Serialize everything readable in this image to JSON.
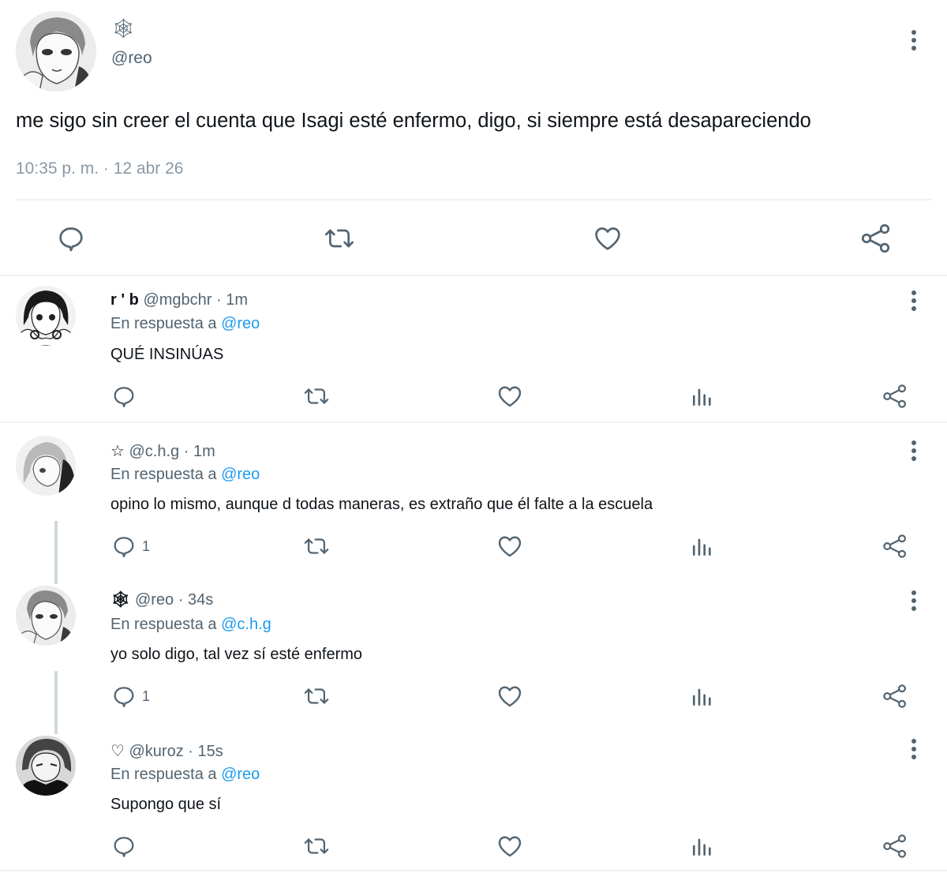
{
  "colors": {
    "text_primary": "#0f1419",
    "text_secondary": "#536471",
    "link": "#1d9bf0",
    "icon": "#536471",
    "divider": "#eff1f3"
  },
  "main_tweet": {
    "display_name": "🕸",
    "handle": "@reo",
    "text": "me sigo sin creer el cuenta que Isagi esté enfermo, digo, si siempre está desapareciendo",
    "timestamp": "10:35 p. m. · 12 abr 26",
    "actions": [
      "reply-icon",
      "retweet-icon",
      "like-icon",
      "share-icon"
    ]
  },
  "replies": [
    {
      "display_name": "r ' b",
      "handle": "@mgbchr",
      "time": "· 1m",
      "replying_prefix": "En respuesta a",
      "replying_to": "@reo",
      "text": "QUÉ INSINÚAS",
      "reply_count": ""
    },
    {
      "display_name": "☆",
      "handle": "@c.h.g",
      "time": "· 1m",
      "replying_prefix": "En respuesta a",
      "replying_to": "@reo",
      "text": "opino lo mismo, aunque d todas maneras, es extraño que él falte a la escuela",
      "reply_count": "1"
    },
    {
      "display_name": "🕸",
      "handle": "@reo",
      "time": "· 34s",
      "replying_prefix": "En respuesta a",
      "replying_to": "@c.h.g",
      "text": "yo solo digo, tal vez sí esté enfermo",
      "reply_count": "1"
    },
    {
      "display_name": "♡",
      "handle": "@kuroz",
      "time": "· 15s",
      "replying_prefix": "En respuesta a",
      "replying_to": "@reo",
      "text": "Supongo que sí",
      "reply_count": ""
    }
  ]
}
